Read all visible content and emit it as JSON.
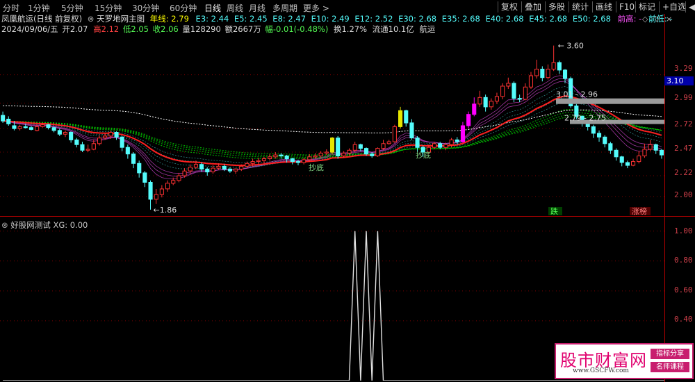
{
  "toolbar": {
    "periods": [
      "分时",
      "1分钟",
      "5分钟",
      "15分钟",
      "30分钟",
      "60分钟",
      "日线",
      "周线",
      "月线",
      "多周期",
      "更多 >"
    ],
    "active_period": "日线",
    "right_buttons": [
      "复权",
      "叠加",
      "多股",
      "统计",
      "画线",
      "F10",
      "标记",
      "+自选",
      "◀"
    ]
  },
  "header": {
    "stock_title": "凤凰航运(日线 前复权)",
    "indicator_name": "天罗地网主图",
    "year_line": "年线: 2.79",
    "ema": [
      "E3: 2.44",
      "E5: 2.45",
      "E8: 2.47",
      "E10: 2.49",
      "E12: 2.52",
      "E30: 2.68",
      "E35: 2.68",
      "E40: 2.68",
      "E45: 2.68",
      "E50: 2.68"
    ],
    "prev_high": "前高: -",
    "prev_low": "前低: -"
  },
  "quote": {
    "date": "2024/09/06/五",
    "open": "开2.07",
    "high": "高2.12",
    "low": "低2.05",
    "close": "收2.06",
    "volume": "量128290",
    "amount": "额2667万",
    "change": "幅-0.01(-0.48%)",
    "turnover": "换1.27%",
    "float": "流通10.1亿",
    "sector": "航运"
  },
  "price_axis": [
    "3.29",
    "2.99",
    "2.72",
    "2.47",
    "2.22",
    "2.00"
  ],
  "price_marker": "3.10",
  "annotations": {
    "high_label": "3.60",
    "low_label": "1.86",
    "level1": "3.01 - 2.96",
    "level2": "2.79 - 2.75",
    "bottom_signal": "抄底",
    "drop_label": "跌",
    "limit_label": "涨榜"
  },
  "indicator": {
    "title": "好股网测试 XG: 0.00",
    "axis": [
      "1.00",
      "0.80",
      "0.60",
      "0.40"
    ]
  },
  "watermark": {
    "brand": "股市财富网",
    "tag1": "指标分享",
    "tag2": "名师课程",
    "url": "www.GSCFW.com"
  },
  "colors": {
    "up": "#ff3232",
    "down": "#54fcfc",
    "gold": "#e6e600",
    "magenta": "#ff00ff",
    "green_band": "#00c800"
  },
  "chart_data": {
    "type": "candlestick",
    "candles": [
      [
        2.86,
        2.8,
        2.9,
        2.78
      ],
      [
        2.82,
        2.77,
        2.85,
        2.75
      ],
      [
        2.75,
        2.72,
        2.8,
        2.7
      ],
      [
        2.72,
        2.74,
        2.76,
        2.7
      ],
      [
        2.74,
        2.73,
        2.77,
        2.72
      ],
      [
        2.73,
        2.71,
        2.75,
        2.7
      ],
      [
        2.7,
        2.74,
        2.76,
        2.69
      ],
      [
        2.74,
        2.76,
        2.78,
        2.73
      ],
      [
        2.76,
        2.73,
        2.77,
        2.71
      ],
      [
        2.73,
        2.7,
        2.74,
        2.68
      ],
      [
        2.7,
        2.66,
        2.72,
        2.64
      ],
      [
        2.66,
        2.68,
        2.7,
        2.63
      ],
      [
        2.68,
        2.6,
        2.69,
        2.57
      ],
      [
        2.6,
        2.55,
        2.62,
        2.52
      ],
      [
        2.55,
        2.49,
        2.58,
        2.47
      ],
      [
        2.49,
        2.5,
        2.55,
        2.47
      ],
      [
        2.5,
        2.56,
        2.6,
        2.49
      ],
      [
        2.56,
        2.62,
        2.65,
        2.54
      ],
      [
        2.62,
        2.64,
        2.67,
        2.6
      ],
      [
        2.64,
        2.68,
        2.7,
        2.61
      ],
      [
        2.68,
        2.63,
        2.69,
        2.6
      ],
      [
        2.63,
        2.52,
        2.64,
        2.48
      ],
      [
        2.52,
        2.45,
        2.55,
        2.4
      ],
      [
        2.45,
        2.35,
        2.47,
        2.3
      ],
      [
        2.35,
        2.25,
        2.38,
        2.2
      ],
      [
        2.25,
        2.15,
        2.27,
        2.1
      ],
      [
        2.15,
        1.97,
        2.17,
        1.86
      ],
      [
        1.97,
        2.02,
        2.08,
        1.92
      ],
      [
        2.02,
        2.08,
        2.12,
        1.99
      ],
      [
        2.08,
        2.14,
        2.17,
        2.05
      ],
      [
        2.14,
        2.17,
        2.2,
        2.12
      ],
      [
        2.17,
        2.22,
        2.25,
        2.15
      ],
      [
        2.22,
        2.27,
        2.3,
        2.2
      ],
      [
        2.27,
        2.31,
        2.34,
        2.24
      ],
      [
        2.31,
        2.34,
        2.38,
        2.29
      ],
      [
        2.34,
        2.29,
        2.36,
        2.26
      ],
      [
        2.29,
        2.26,
        2.31,
        2.22
      ],
      [
        2.26,
        2.3,
        2.33,
        2.24
      ],
      [
        2.3,
        2.32,
        2.35,
        2.28
      ],
      [
        2.32,
        2.29,
        2.34,
        2.27
      ],
      [
        2.29,
        2.27,
        2.31,
        2.25
      ],
      [
        2.27,
        2.29,
        2.3,
        2.24
      ],
      [
        2.29,
        2.32,
        2.34,
        2.27
      ],
      [
        2.32,
        2.35,
        2.37,
        2.3
      ],
      [
        2.35,
        2.37,
        2.4,
        2.32
      ],
      [
        2.37,
        2.38,
        2.41,
        2.34
      ],
      [
        2.38,
        2.4,
        2.42,
        2.35
      ],
      [
        2.4,
        2.42,
        2.45,
        2.38
      ],
      [
        2.42,
        2.44,
        2.47,
        2.4
      ],
      [
        2.44,
        2.43,
        2.46,
        2.4
      ],
      [
        2.43,
        2.4,
        2.44,
        2.36
      ],
      [
        2.4,
        2.37,
        2.41,
        2.34
      ],
      [
        2.37,
        2.36,
        2.39,
        2.33
      ],
      [
        2.36,
        2.39,
        2.41,
        2.34
      ],
      [
        2.39,
        2.42,
        2.45,
        2.37
      ],
      [
        2.42,
        2.43,
        2.46,
        2.4
      ],
      [
        2.43,
        2.46,
        2.48,
        2.41
      ],
      [
        2.46,
        2.47,
        2.5,
        2.44
      ],
      [
        2.47,
        2.62,
        2.63,
        2.45
      ],
      [
        2.62,
        2.43,
        2.64,
        2.4
      ],
      [
        2.43,
        2.46,
        2.48,
        2.41
      ],
      [
        2.46,
        2.49,
        2.51,
        2.44
      ],
      [
        2.49,
        2.55,
        2.58,
        2.47
      ],
      [
        2.55,
        2.51,
        2.56,
        2.48
      ],
      [
        2.51,
        2.45,
        2.52,
        2.43
      ],
      [
        2.45,
        2.43,
        2.47,
        2.41
      ],
      [
        2.43,
        2.51,
        2.52,
        2.42
      ],
      [
        2.51,
        2.56,
        2.6,
        2.49
      ],
      [
        2.56,
        2.58,
        2.6,
        2.55
      ],
      [
        2.58,
        2.74,
        2.76,
        2.57
      ],
      [
        2.74,
        2.91,
        2.95,
        2.72
      ],
      [
        2.91,
        2.78,
        2.92,
        2.74
      ],
      [
        2.78,
        2.62,
        2.82,
        2.6
      ],
      [
        2.62,
        2.52,
        2.64,
        2.47
      ],
      [
        2.52,
        2.47,
        2.54,
        2.42
      ],
      [
        2.47,
        2.52,
        2.55,
        2.45
      ],
      [
        2.52,
        2.56,
        2.58,
        2.5
      ],
      [
        2.56,
        2.52,
        2.58,
        2.5
      ],
      [
        2.52,
        2.55,
        2.57,
        2.49
      ],
      [
        2.55,
        2.6,
        2.62,
        2.52
      ],
      [
        2.6,
        2.58,
        2.63,
        2.55
      ],
      [
        2.58,
        2.75,
        2.79,
        2.57
      ],
      [
        2.75,
        2.87,
        2.9,
        2.72
      ],
      [
        2.87,
        2.98,
        3.05,
        2.85
      ],
      [
        2.98,
        3.05,
        3.12,
        2.95
      ],
      [
        3.05,
        2.95,
        3.08,
        2.9
      ],
      [
        2.95,
        3.01,
        3.04,
        2.92
      ],
      [
        3.01,
        3.06,
        3.1,
        2.98
      ],
      [
        3.06,
        3.17,
        3.2,
        3.03
      ],
      [
        3.17,
        3.2,
        3.26,
        3.14
      ],
      [
        3.2,
        3.04,
        3.22,
        3.0
      ],
      [
        3.04,
        3.03,
        3.08,
        3.0
      ],
      [
        3.03,
        3.16,
        3.2,
        3.02
      ],
      [
        3.16,
        3.28,
        3.32,
        3.14
      ],
      [
        3.28,
        3.35,
        3.45,
        3.25
      ],
      [
        3.35,
        3.26,
        3.38,
        3.22
      ],
      [
        3.26,
        3.35,
        3.4,
        3.24
      ],
      [
        3.35,
        3.42,
        3.6,
        3.33
      ],
      [
        3.42,
        3.34,
        3.44,
        3.3
      ],
      [
        3.34,
        3.25,
        3.35,
        3.2
      ],
      [
        3.25,
        2.96,
        3.27,
        2.94
      ],
      [
        2.96,
        2.85,
        2.98,
        2.82
      ],
      [
        2.85,
        2.79,
        2.86,
        2.74
      ],
      [
        2.79,
        2.74,
        2.81,
        2.7
      ],
      [
        2.74,
        2.67,
        2.76,
        2.62
      ],
      [
        2.67,
        2.63,
        2.7,
        2.58
      ],
      [
        2.63,
        2.56,
        2.65,
        2.52
      ],
      [
        2.56,
        2.49,
        2.58,
        2.45
      ],
      [
        2.49,
        2.42,
        2.51,
        2.38
      ],
      [
        2.42,
        2.36,
        2.43,
        2.32
      ],
      [
        2.36,
        2.33,
        2.38,
        2.3
      ],
      [
        2.33,
        2.37,
        2.4,
        2.32
      ],
      [
        2.37,
        2.43,
        2.48,
        2.35
      ],
      [
        2.43,
        2.5,
        2.56,
        2.41
      ],
      [
        2.5,
        2.55,
        2.6,
        2.48
      ],
      [
        2.55,
        2.49,
        2.56,
        2.45
      ],
      [
        2.49,
        2.44,
        2.5,
        2.4
      ]
    ],
    "signal": [
      0,
      0,
      0,
      0,
      0,
      0,
      0,
      0,
      0,
      0,
      0,
      0,
      0,
      0,
      0,
      0,
      0,
      0,
      0,
      0,
      0,
      0,
      0,
      0,
      0,
      0,
      0,
      0,
      0,
      0,
      0,
      0,
      0,
      0,
      0,
      0,
      0,
      0,
      0,
      0,
      0,
      0,
      0,
      0,
      0,
      0,
      0,
      0,
      0,
      0,
      0,
      0,
      0,
      0,
      0,
      0,
      0,
      0,
      0,
      0,
      0,
      0,
      1,
      0,
      1,
      0,
      1,
      0,
      0,
      0,
      0,
      0,
      0,
      0,
      0,
      0,
      0,
      0,
      0,
      0,
      0,
      0,
      0,
      0,
      0,
      0,
      0,
      0,
      0,
      0,
      0,
      0,
      0,
      0,
      0,
      0,
      0,
      0,
      0,
      0,
      0,
      0,
      0,
      0,
      0,
      0,
      0,
      0,
      0,
      0,
      0,
      0,
      0,
      0,
      0,
      0,
      0,
      0,
      0
    ],
    "year_line_level": 2.79,
    "price_range": [
      1.8,
      3.7
    ],
    "signal_range": [
      0,
      1.05
    ]
  }
}
